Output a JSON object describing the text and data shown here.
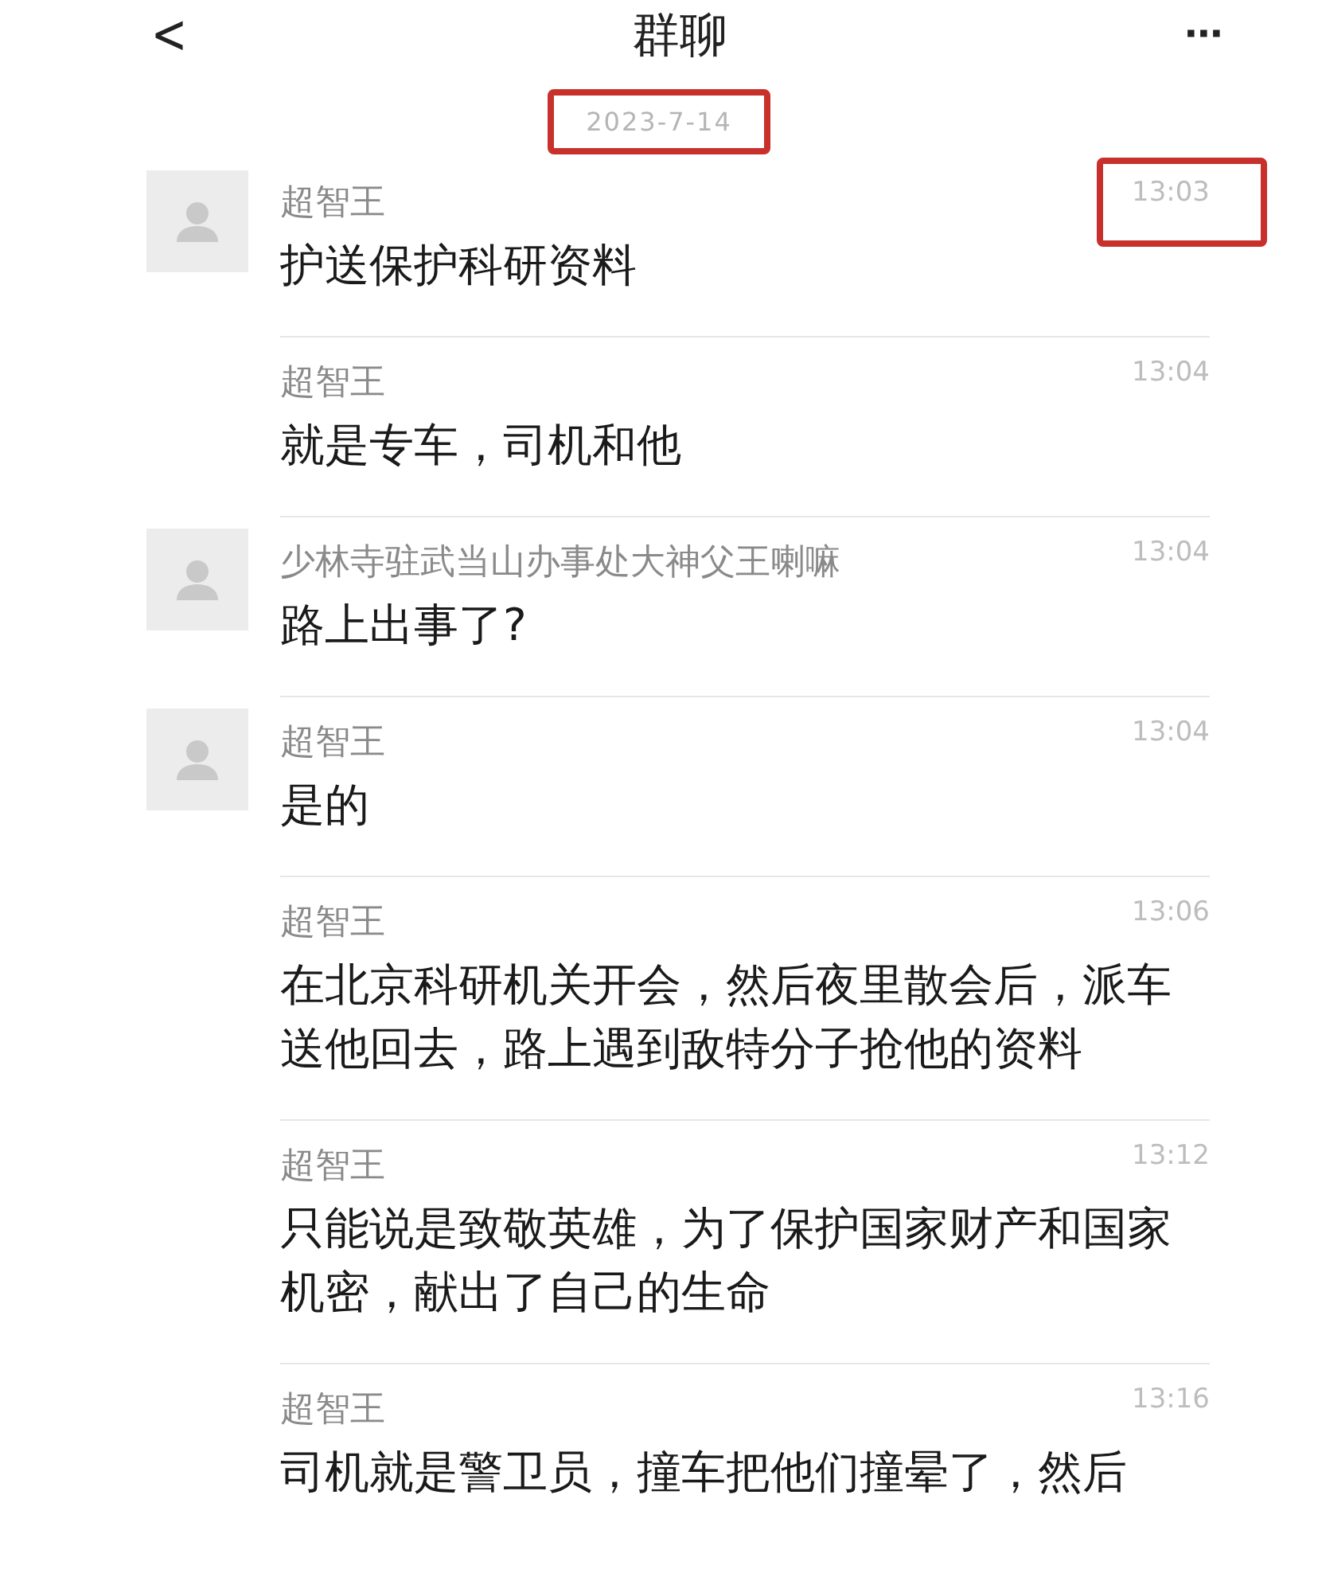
{
  "header": {
    "back": "<",
    "title": "群聊",
    "more": "···"
  },
  "date": {
    "text": "2023-7-14",
    "highlighted": true
  },
  "messages": [
    {
      "sender": "超智王",
      "time": "13:03",
      "text": "护送保护科研资料",
      "avatar": true,
      "time_highlighted": true
    },
    {
      "sender": "超智王",
      "time": "13:04",
      "text": "就是专车，司机和他",
      "avatar": false,
      "time_highlighted": false
    },
    {
      "sender": "少林寺驻武当山办事处大神父王喇嘛",
      "time": "13:04",
      "text": "路上出事了?",
      "avatar": true,
      "time_highlighted": false
    },
    {
      "sender": "超智王",
      "time": "13:04",
      "text": "是的",
      "avatar": true,
      "time_highlighted": false
    },
    {
      "sender": "超智王",
      "time": "13:06",
      "text": "在北京科研机关开会，然后夜里散会后，派车送他回去，路上遇到敌特分子抢他的资料",
      "avatar": false,
      "time_highlighted": false
    },
    {
      "sender": "超智王",
      "time": "13:12",
      "text": "只能说是致敬英雄，为了保护国家财产和国家机密，献出了自己的生命",
      "avatar": false,
      "time_highlighted": false
    },
    {
      "sender": "超智王",
      "time": "13:16",
      "text": "司机就是警卫员，撞车把他们撞晕了，然后",
      "avatar": false,
      "time_highlighted": false
    }
  ]
}
